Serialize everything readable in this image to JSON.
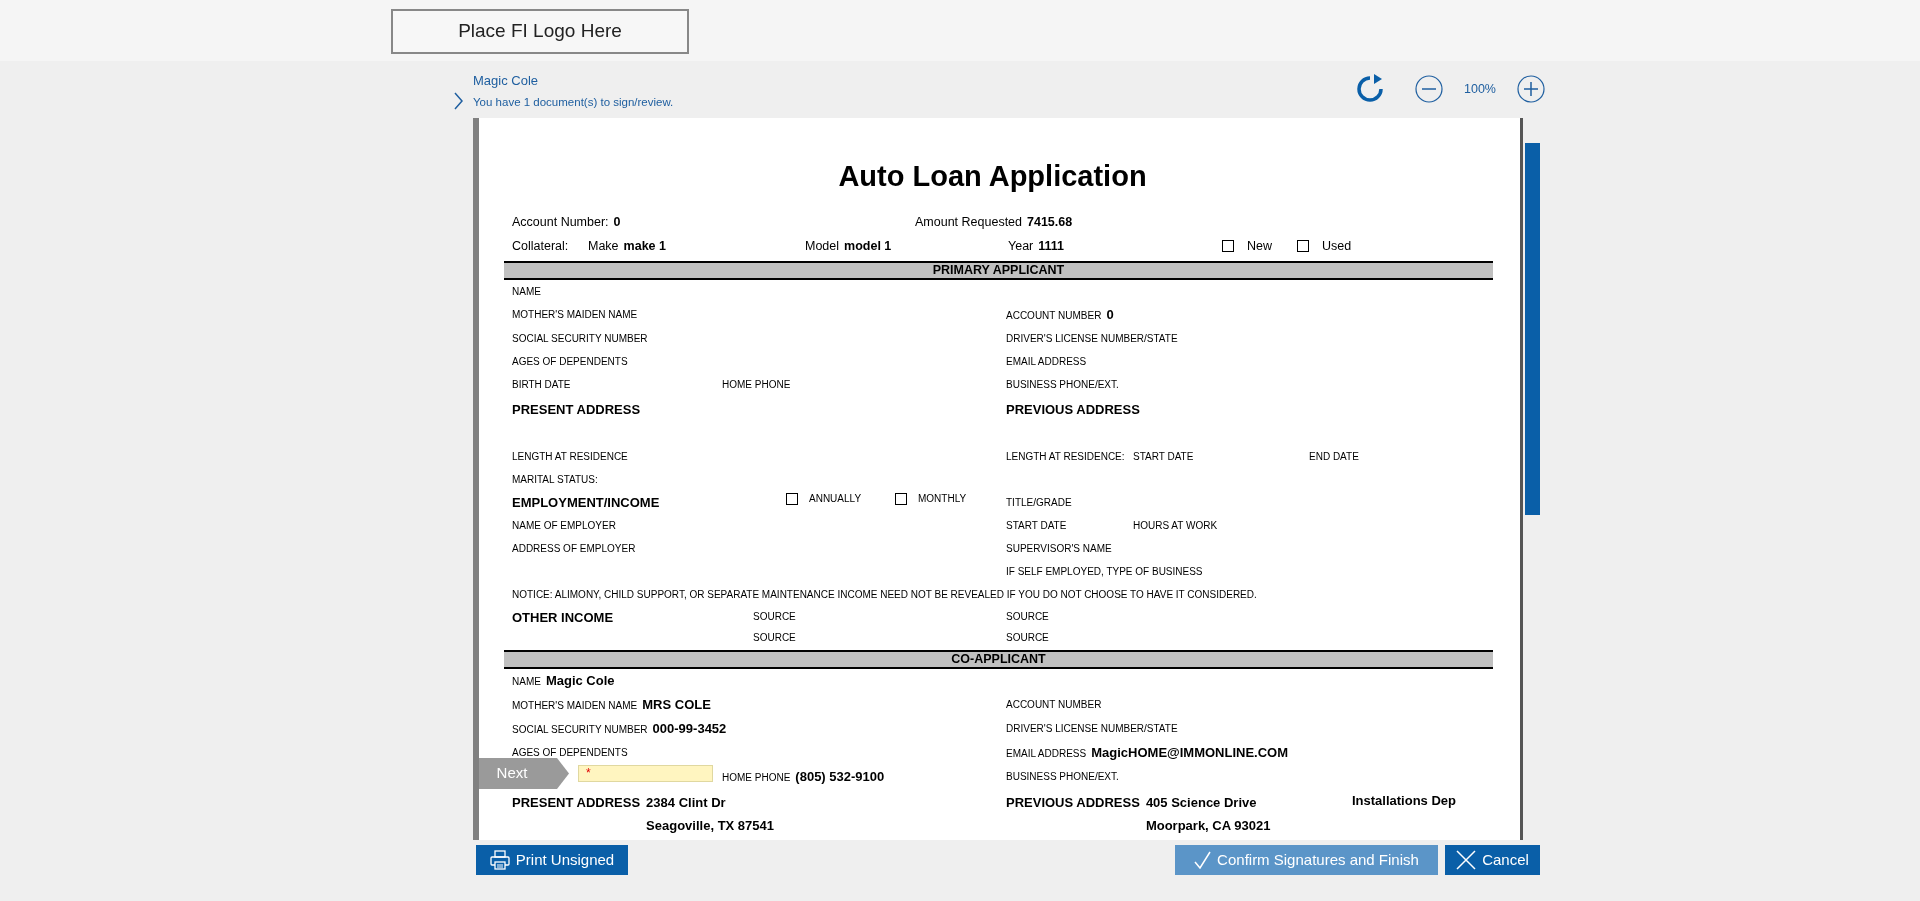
{
  "header": {
    "logo_placeholder": "Place FI Logo Here"
  },
  "signer": {
    "name": "Magic Cole",
    "message": "You have 1 document(s) to sign/review."
  },
  "zoom": {
    "level_text": "100%"
  },
  "document": {
    "title": "Auto Loan Application",
    "summary": [
      [
        {
          "label": "Account Number:",
          "value": "0"
        },
        {
          "label": "Amount Requested",
          "value": "7415.68"
        }
      ],
      [
        {
          "label": "Collateral:"
        },
        {
          "label": "Make",
          "value": "make 1"
        },
        {
          "label": "Model",
          "value": "model 1"
        },
        {
          "label": "Year",
          "value": "1111"
        },
        {
          "kind": "checkbox",
          "label": "New",
          "checked": false
        },
        {
          "kind": "checkbox",
          "label": "Used",
          "checked": false
        }
      ]
    ],
    "next_button": {
      "label": "Next"
    },
    "sections": [
      {
        "title": "PRIMARY APPLICANT",
        "rows": [
          {
            "left": [
              {
                "label": "NAME"
              }
            ]
          },
          {
            "left": [
              {
                "label": "MOTHER'S MAIDEN NAME"
              }
            ],
            "right": [
              {
                "label": "ACCOUNT NUMBER",
                "value": "0"
              }
            ]
          },
          {
            "left": [
              {
                "label": "SOCIAL SECURITY NUMBER"
              }
            ],
            "right": [
              {
                "label": "DRIVER'S LICENSE NUMBER/STATE"
              }
            ]
          },
          {
            "left": [
              {
                "label": "AGES OF DEPENDENTS"
              }
            ],
            "right": [
              {
                "label": "EMAIL ADDRESS"
              }
            ]
          },
          {
            "left": [
              {
                "label": "BIRTH DATE"
              },
              {
                "label": "HOME PHONE"
              }
            ],
            "right": [
              {
                "label": "BUSINESS PHONE/EXT."
              }
            ]
          },
          {
            "left": [
              {
                "kind": "address",
                "label": "PRESENT ADDRESS"
              }
            ],
            "right": [
              {
                "kind": "address",
                "label": "PREVIOUS ADDRESS"
              }
            ]
          },
          {
            "left": [
              {
                "label": "LENGTH AT RESIDENCE"
              }
            ],
            "right": [
              {
                "label": "LENGTH AT RESIDENCE:"
              },
              {
                "label": "START DATE"
              },
              {
                "label": "END DATE"
              }
            ]
          },
          {
            "left": [
              {
                "label": "MARITAL STATUS:"
              }
            ]
          },
          {
            "left": [
              {
                "kind": "heading",
                "label": "EMPLOYMENT/INCOME"
              },
              {
                "kind": "checkbox",
                "label": "ANNUALLY",
                "checked": false
              },
              {
                "kind": "checkbox",
                "label": "MONTHLY",
                "checked": false
              }
            ],
            "right": [
              {
                "label": "TITLE/GRADE"
              }
            ]
          },
          {
            "left": [
              {
                "label": "NAME OF EMPLOYER"
              }
            ],
            "right": [
              {
                "label": "START DATE"
              },
              {
                "label": "HOURS AT WORK"
              }
            ]
          },
          {
            "left": [
              {
                "label": "ADDRESS OF EMPLOYER"
              }
            ],
            "right": [
              {
                "label": "SUPERVISOR'S NAME"
              }
            ]
          },
          {
            "right": [
              {
                "label": "IF SELF EMPLOYED, TYPE OF BUSINESS"
              }
            ]
          },
          {
            "notice": "NOTICE: ALIMONY, CHILD SUPPORT, OR SEPARATE MAINTENANCE INCOME NEED NOT BE REVEALED IF YOU DO NOT CHOOSE TO HAVE IT CONSIDERED."
          },
          {
            "left": [
              {
                "kind": "heading",
                "label": "OTHER INCOME"
              },
              {
                "kind": "sources",
                "labels": [
                  "SOURCE",
                  "SOURCE"
                ]
              }
            ],
            "right": [
              {
                "kind": "sources",
                "labels": [
                  "SOURCE",
                  "SOURCE"
                ]
              }
            ]
          }
        ]
      },
      {
        "title": "CO-APPLICANT",
        "rows": [
          {
            "left": [
              {
                "label": "NAME",
                "value": "Magic Cole"
              }
            ]
          },
          {
            "left": [
              {
                "label": "MOTHER'S MAIDEN NAME",
                "value": "MRS COLE"
              }
            ],
            "right": [
              {
                "label": "ACCOUNT NUMBER"
              }
            ]
          },
          {
            "left": [
              {
                "label": "SOCIAL SECURITY NUMBER",
                "value": "000-99-3452"
              }
            ],
            "right": [
              {
                "label": "DRIVER'S LICENSE NUMBER/STATE"
              }
            ]
          },
          {
            "left": [
              {
                "label": "AGES OF DEPENDENTS"
              }
            ],
            "right": [
              {
                "label": "EMAIL ADDRESS",
                "value": "MagicHOME@IMMONLINE.COM"
              }
            ]
          },
          {
            "left": [
              {
                "kind": "entry",
                "required_mark": "*"
              },
              {
                "label": "HOME PHONE",
                "value": "(805) 532-9100"
              }
            ],
            "right": [
              {
                "label": "BUSINESS PHONE/EXT."
              }
            ]
          },
          {
            "left": [
              {
                "kind": "address",
                "label": "PRESENT ADDRESS",
                "lines": [
                  "2384 Clint Dr",
                  "Seagoville, TX 87541"
                ]
              }
            ],
            "right": [
              {
                "kind": "address",
                "label": "PREVIOUS ADDRESS",
                "lines": [
                  "405 Science Drive",
                  "Moorpark, CA 93021"
                ]
              },
              {
                "kind": "value",
                "value": "Installations Dep"
              }
            ]
          }
        ]
      }
    ]
  },
  "buttons": [
    {
      "kind": "print",
      "label": "Print Unsigned"
    },
    {
      "kind": "confirm",
      "label": "Confirm Signatures and Finish"
    },
    {
      "kind": "cancel",
      "label": "Cancel"
    }
  ]
}
